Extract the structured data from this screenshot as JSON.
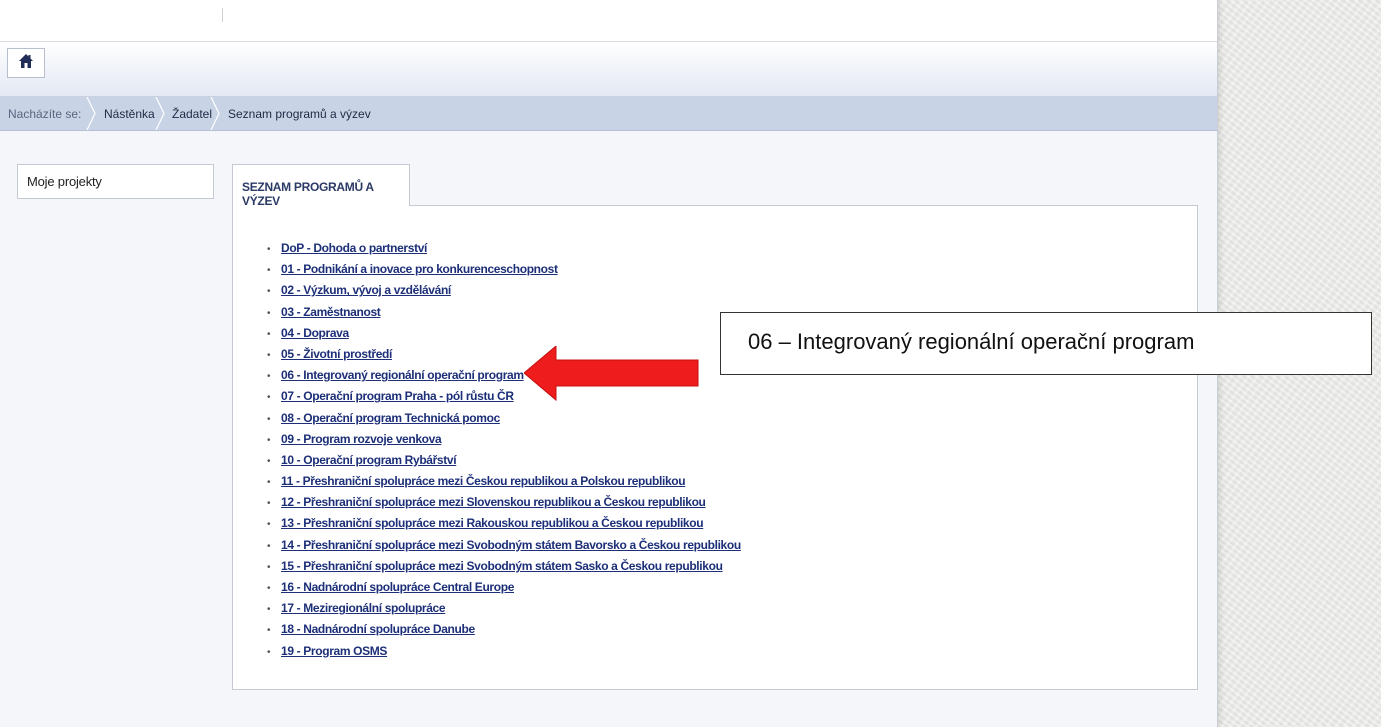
{
  "colors": {
    "accent": "#1c2f78",
    "arrow": "#ee1c1c",
    "breadcrumb_bg": "#c9d3e6"
  },
  "toolbar": {
    "home_icon": "home-icon"
  },
  "breadcrumb": {
    "prefix": "Nacházíte se:",
    "items": [
      "Nástěnka",
      "Žadatel",
      "Seznam programů a výzev"
    ]
  },
  "sidebar": {
    "items": [
      {
        "label": "Moje projekty"
      }
    ]
  },
  "main": {
    "tab_label": "SEZNAM PROGRAMŮ A VÝZEV",
    "programs": [
      "DoP - Dohoda o partnerství",
      "01 - Podnikání a inovace pro konkurenceschopnost",
      "02 - Výzkum, vývoj a vzdělávání",
      "03 - Zaměstnanost",
      "04 - Doprava",
      "05 - Životní prostředí",
      "06 - Integrovaný regionální operační program",
      "07 - Operační program Praha - pól růstu ČR",
      "08 - Operační program Technická pomoc",
      "09 - Program rozvoje venkova",
      "10 - Operační program Rybářství",
      "11 - Přeshraniční spolupráce mezi Českou republikou a Polskou republikou",
      "12 - Přeshraniční spolupráce mezi Slovenskou republikou a Českou republikou",
      "13 - Přeshraniční spolupráce mezi Rakouskou republikou a Českou republikou",
      "14 - Přeshraniční spolupráce mezi Svobodným státem Bavorsko a Českou republikou",
      "15 - Přeshraniční spolupráce mezi Svobodným státem Sasko a Českou republikou",
      "16 - Nadnárodní spolupráce Central Europe",
      "17 - Meziregionální spolupráce",
      "18 - Nadnárodní spolupráce Danube",
      "19 - Program OSMS"
    ]
  },
  "annotation": {
    "callout_text": "06 – Integrovaný regionální operační program",
    "arrow_icon": "red-arrow-left-icon"
  }
}
